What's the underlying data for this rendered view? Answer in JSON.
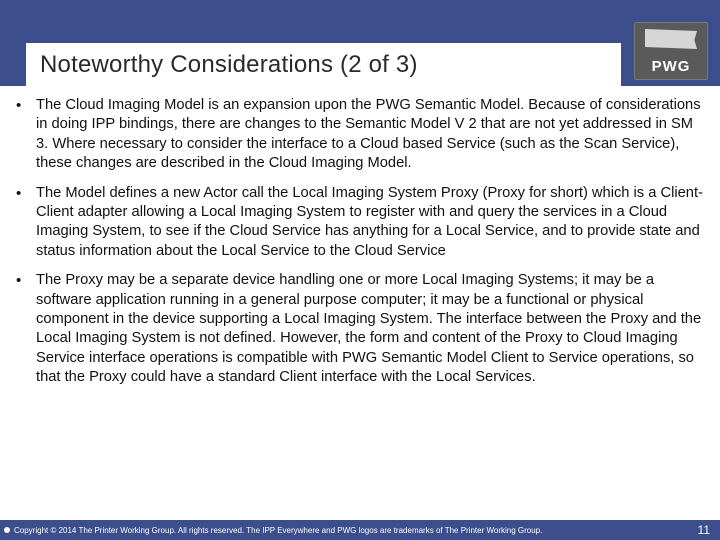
{
  "header": {
    "title": "Noteworthy Considerations (2 of 3)",
    "logo_text": "PWG"
  },
  "bullets": [
    "The Cloud Imaging Model is an expansion upon the PWG Semantic Model. Because of considerations in doing IPP bindings, there  are changes to the Semantic Model V 2  that are not yet addressed in SM 3. Where necessary to consider the interface to a Cloud based Service (such as the Scan Service), these changes are described in the Cloud Imaging Model.",
    "The Model  defines a new Actor call the Local Imaging System Proxy (Proxy for short) which is a Client-Client  adapter allowing a Local Imaging System to register with and query the services in a Cloud Imaging System, to see if the Cloud Service has anything for a Local Service, and to provide state and status information about the Local Service to the Cloud Service",
    "The Proxy may be a separate device handling one or more Local Imaging Systems; it may be a software application running in a general purpose computer; it may be a functional or physical component in the device supporting a Local Imaging System. The interface between the Proxy and the Local Imaging System is not defined. However,  the form and content of the Proxy to Cloud  Imaging Service interface operations is compatible with PWG Semantic Model Client to Service operations, so that the Proxy could have a standard Client interface with the Local Services."
  ],
  "footer": {
    "copyright": "Copyright © 2014 The Printer Working Group. All rights reserved. The IPP Everywhere and PWG logos are trademarks of The Printer Working Group.",
    "page_number": "11"
  }
}
